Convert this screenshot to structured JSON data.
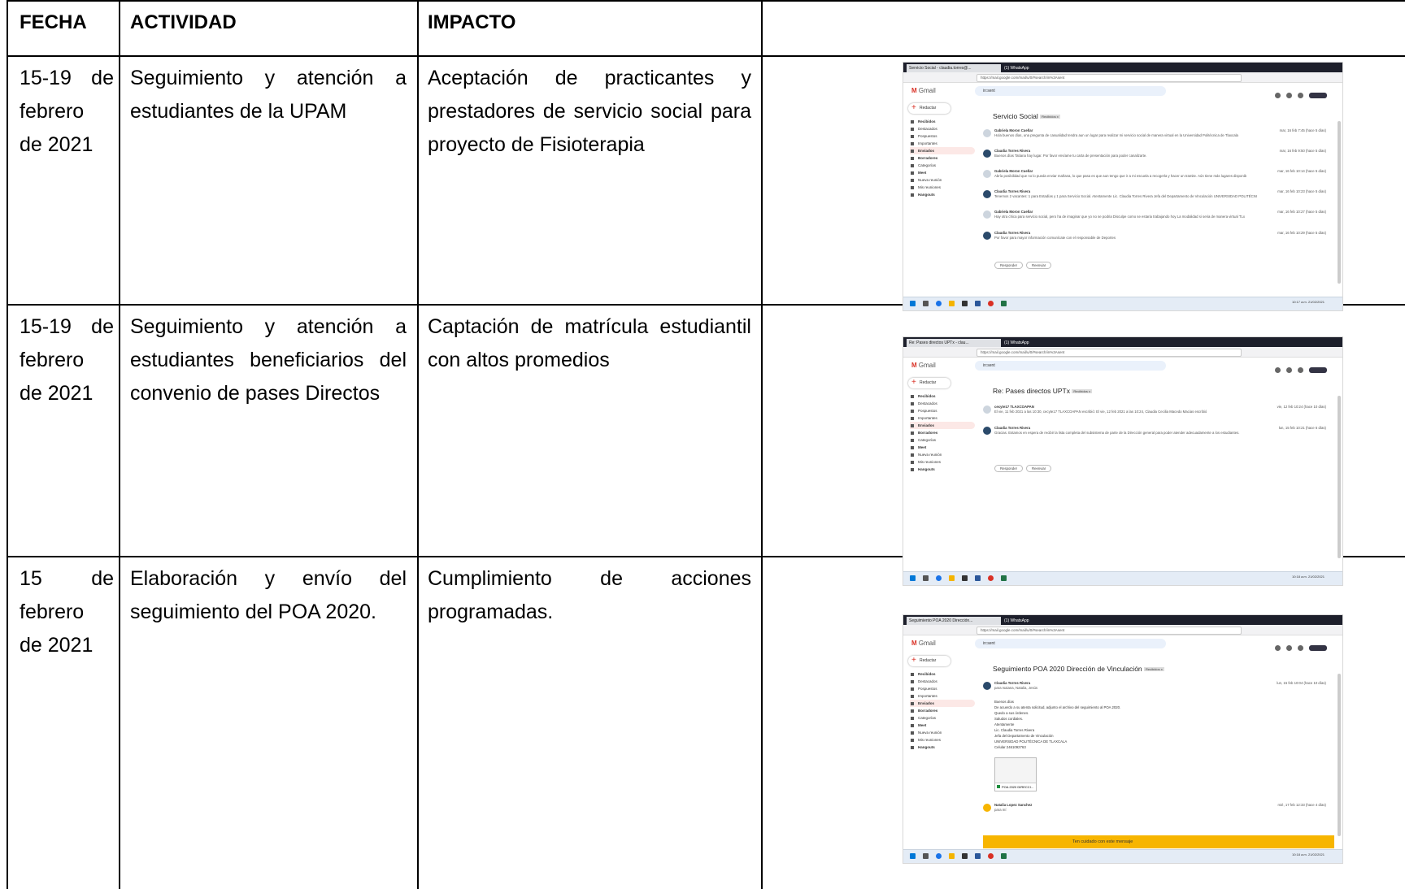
{
  "headers": [
    "FECHA",
    "ACTIVIDAD",
    "IMPACTO"
  ],
  "rows": [
    {
      "fecha_lines": [
        "15-19 de",
        "febrero",
        "de 2021"
      ],
      "actividad_lines": [
        "Seguimiento y atención a",
        "estudiantes de la UPAM"
      ],
      "impacto_lines": [
        "Aceptación de practicantes y",
        "prestadores de servicio social para",
        "proyecto de Fisioterapia"
      ],
      "screenshot": {
        "tab": "Servicio Social - claudia.torres@...",
        "tab2": "(1) WhatsApp",
        "url": "https://mail.google.com/mail/u/0/#search/in%3Asent",
        "search": "in:sent",
        "subject": "Servicio Social",
        "label": "Recibidos x",
        "messages": [
          {
            "from": "Gabriela Moron Cuellar",
            "snippet": "Hola buenos días, una pregunta de casualidad tendra aun un lugar para realizar mi servicio social de manera virtual en la Universidad Politécnica de Tlaxcala",
            "date": "mar, 16 feb 7:45 (hace 5 días)"
          },
          {
            "from": "Claudia Torres Rivera",
            "snippet": "Buenos días Tatiana hay lugar. Por favor envíame tu carta de presentación para poder canalizarte.",
            "date": "mar, 16 feb 9:50 (hace 5 días)"
          },
          {
            "from": "Gabriela Moron Cuellar",
            "snippet": "Abría posibilidad que no lo pueda enviar mañana, lo que pasa es que aun tengo que ir a mi escuela a recogerla y hacer un tramite. Aún tiene más lugares disponib",
            "date": "mar, 16 feb 10:14 (hace 5 días)"
          },
          {
            "from": "Claudia Torres Rivera",
            "snippet": "Tenemos 2 vacantes: 1 para Estadías y 1 para Servicio Social. Atentamente Lic. Claudia Torres Rivera Jefa del Departamento de Vinculación UNIVERSIDAD POLITÉCNI",
            "date": "mar, 16 feb 10:23 (hace 5 días)"
          },
          {
            "from": "Gabriela Moron Cuellar",
            "snippet": "Hay otra chica para servicio social, pero ha de imaginar que yo no se podria Disculpe como se estaria trabajando hoy La modalidad si seria de manera virtual TLx",
            "date": "mar, 16 feb 10:27 (hace 5 días)"
          },
          {
            "from": "Claudia Torres Rivera",
            "snippet": "Por favor para mayor información comunícate con el responsable de Deportes",
            "date": "mar, 16 feb 10:29 (hace 5 días)"
          }
        ],
        "reply": "Responder",
        "forward": "Reenviar",
        "clock": "10:17 a.m. 21/02/2021"
      }
    },
    {
      "fecha_lines": [
        "15-19 de",
        "febrero",
        "de 2021"
      ],
      "actividad_lines": [
        "Seguimiento y atención a",
        "estudiantes beneficiarios del",
        "convenio de pases Directos"
      ],
      "impacto_lines": [
        "Captación de matrícula estudiantil",
        "con altos promedios"
      ],
      "screenshot": {
        "tab": "Re: Pases directos UPTx - clau...",
        "tab2": "(1) WhatsApp",
        "url": "https://mail.google.com/mail/u/0/#search/in%3Asent",
        "search": "in:sent",
        "subject": "Re: Pases directos UPTx",
        "label": "Recibidos x",
        "messages": [
          {
            "from": "cecyte17 TLAXCOAPAN",
            "snippet": "El vie, 11 feb 2021 a las 10:30, cecyte17 TLAXCOAPAN escribió: El vie, 12 feb 2021 a las 10:24, Claudia Cecilia Macedo Macias escribió",
            "date": "vie, 12 feb 10:24 (hace 10 días)"
          },
          {
            "from": "Claudia Torres Rivera",
            "snippet": "Gracias. Estamos en espera de recibir la lista completa del subsistema de parte de la Dirección general para poder atender adecuadamente a los estudiantes.",
            "date": "lun, 15 feb 10:21 (hace 6 días)"
          }
        ],
        "reply": "Responder",
        "forward": "Reenviar",
        "clock": "10:18 a.m. 21/02/2021"
      }
    },
    {
      "fecha_lines": [
        "15 de",
        "febrero",
        "de 2021"
      ],
      "actividad_lines": [
        "Elaboración y envío del",
        "seguimiento del POA 2020."
      ],
      "impacto_lines": [
        "Cumplimiento de acciones",
        "programadas."
      ],
      "screenshot": {
        "tab": "Seguimiento POA 2020 Dirección...",
        "tab2": "(1) WhatsApp",
        "url": "https://mail.google.com/mail/u/0/#search/in%3Asent",
        "search": "in:sent",
        "subject": "Seguimiento POA 2020 Dirección de Vinculación",
        "label": "Recibidos x",
        "messages": [
          {
            "from": "Claudia Torres Rivera",
            "snippet": "para Isaiana, Natalia, Jesús",
            "date": "lun, 15 feb 10:04 (hace 10 días)"
          }
        ],
        "body": [
          "Buenos días",
          "De acuerdo a su atenta solicitud, adjunto el archivo del seguimiento al POA 2020.",
          "Quedo a sus órdenes.",
          "Saludos cordiales.",
          "Atentamente",
          "Lic. Claudia Torres Rivera",
          "Jefa del Departamento de Vinculación",
          "UNIVERSIDAD POLITÉCNICA DE TLAXCALA",
          "Celular 2461092763"
        ],
        "attachment": "POA 2020 DIRECCI...",
        "second": {
          "from": "Natalia Lopez Sanchez",
          "snippet": "para mí",
          "date": "mié, 17 feb 12:33 (hace 4 días)"
        },
        "warning": "Ten cuidado con este mensaje",
        "clock": "10:18 a.m. 21/02/2021"
      }
    }
  ],
  "sidebar": [
    "Recibidos",
    "Destacados",
    "Pospuestos",
    "Importantes",
    "Enviados",
    "Borradores",
    "Categorías",
    "Meet",
    "Nueva reunión",
    "Mis reuniones",
    "Hangouts"
  ],
  "gmail_label": "Gmail",
  "compose_label": "Redactar",
  "colors": {
    "gmail_red": "#d93025",
    "taskbar": "#e4ecf6",
    "warning": "#f7b500"
  }
}
